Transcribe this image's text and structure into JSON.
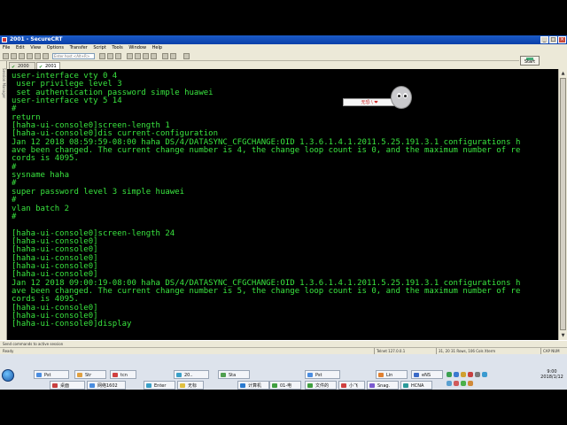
{
  "window": {
    "title": "2001 - SecureCRT"
  },
  "menu": [
    "File",
    "Edit",
    "View",
    "Options",
    "Transfer",
    "Script",
    "Tools",
    "Window",
    "Help"
  ],
  "toolbar": {
    "host_placeholder": "Enter host <Alt+R>"
  },
  "sidebar": {
    "label": "Session Manager"
  },
  "tabs": [
    {
      "label": "2000",
      "active": false
    },
    {
      "label": "2001",
      "active": true
    }
  ],
  "right_panel": {
    "start_label": "Start"
  },
  "terminal": {
    "lines": [
      "user-interface vty 0 4",
      " user privilege level 3",
      " set authentication password simple huawei",
      "user-interface vty 5 14",
      "#",
      "return",
      "[haha-ui-console0]screen-length 1",
      "[haha-ui-console0]dis current-configuration",
      "Jan 12 2018 08:59:59-08:00 haha DS/4/DATASYNC_CFGCHANGE:OID 1.3.6.1.4.1.2011.5.25.191.3.1 configurations h",
      "ave been changed. The current change number is 4, the change loop count is 0, and the maximum number of re",
      "cords is 4095.",
      "#",
      "sysname haha",
      "#",
      "super password level 3 simple huawei",
      "#",
      "vlan batch 2",
      "#",
      "",
      "[haha-ui-console0]screen-length 24",
      "[haha-ui-console0]",
      "[haha-ui-console0]",
      "[haha-ui-console0]",
      "[haha-ui-console0]",
      "[haha-ui-console0]",
      "Jan 12 2018 09:00:19-08:00 haha DS/4/DATASYNC_CFGCHANGE:OID 1.3.6.1.4.1.2011.5.25.191.3.1 configurations h",
      "ave been changed. The current change number is 5, the change loop count is 0, and the maximum number of re",
      "cords is 4095.",
      "[haha-ui-console0]",
      "[haha-ui-console0]",
      "[haha-ui-console0]display"
    ],
    "text_color": "#39e53f",
    "background": "#000000"
  },
  "sticker": {
    "label": "无恐 \\ ❤"
  },
  "status": {
    "message": "Send commands to active session",
    "ready": "Ready",
    "telnet": "Telnet  127.0.0.1",
    "cursor": "31, 20  31 Rows, 106 Cols  Xterm",
    "caps": "CAP NUM"
  },
  "taskbar": {
    "items_row1": [
      "Pst",
      "Str",
      "tcn",
      "20..",
      "Sta",
      "Pst",
      "Lin",
      "eNS"
    ],
    "items_row2": [
      "桌面",
      "网络1602",
      "Enter",
      "无标",
      "计算机",
      "01-电",
      "文件的",
      "小飞",
      "Snag.",
      "HCNA"
    ],
    "time": "9:00",
    "date": "2018/1/12"
  }
}
